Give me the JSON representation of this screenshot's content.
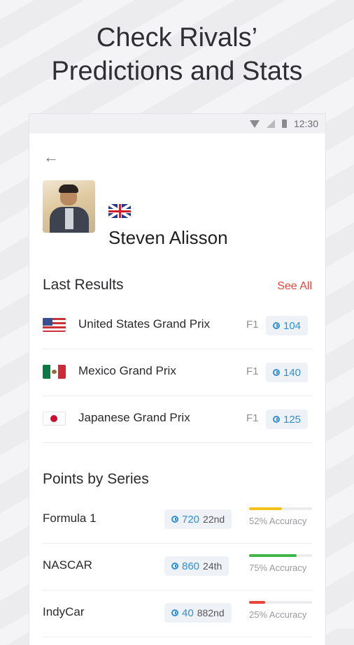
{
  "headline": {
    "line1": "Check Rivals’",
    "line2": "Predictions and Stats"
  },
  "status_bar": {
    "time": "12:30"
  },
  "profile": {
    "name": "Steven Alisson",
    "flag": "uk-flag"
  },
  "last_results": {
    "title": "Last Results",
    "see_all": "See All",
    "items": [
      {
        "name": "United States Grand Prix",
        "series": "F1",
        "points": "104",
        "flag": "us-flag"
      },
      {
        "name": "Mexico Grand Prix",
        "series": "F1",
        "points": "140",
        "flag": "mexico-flag"
      },
      {
        "name": "Japanese Grand Prix",
        "series": "F1",
        "points": "125",
        "flag": "japan-flag"
      }
    ]
  },
  "points_by_series": {
    "title": "Points by Series",
    "items": [
      {
        "name": "Formula 1",
        "points": "720",
        "rank": "22nd",
        "accuracy": 52,
        "accuracy_label": "52% Accuracy",
        "color": "#f2c21b"
      },
      {
        "name": "NASCAR",
        "points": "860",
        "rank": "24th",
        "accuracy": 75,
        "accuracy_label": "75% Accuracy",
        "color": "#43b649"
      },
      {
        "name": "IndyCar",
        "points": "40",
        "rank": "882nd",
        "accuracy": 25,
        "accuracy_label": "25% Accuracy",
        "color": "#e8453c"
      }
    ]
  },
  "colors": {
    "accent": "#e8453c",
    "points": "#2f8fd8"
  }
}
